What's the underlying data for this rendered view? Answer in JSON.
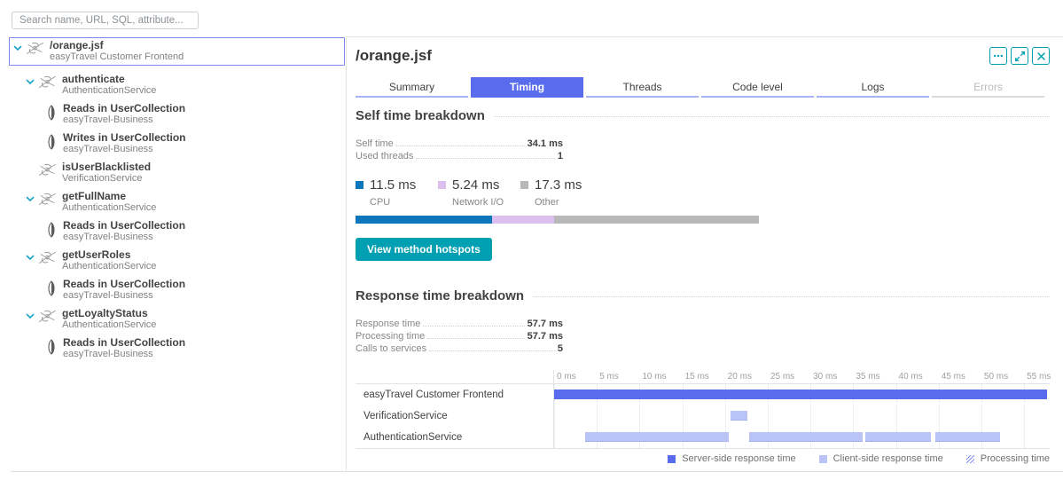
{
  "search": {
    "placeholder": "Search name, URL, SQL, attribute..."
  },
  "tree": {
    "items": [
      {
        "name": "/orange.jsf",
        "service": "easyTravel Customer Frontend",
        "level": 0,
        "icon": "service-icon",
        "expanded": true,
        "selected": true
      },
      {
        "name": "authenticate",
        "service": "AuthenticationService",
        "level": 1,
        "icon": "service-icon",
        "expanded": true
      },
      {
        "name": "Reads in UserCollection",
        "service": "easyTravel-Business",
        "level": 2,
        "icon": "database-icon"
      },
      {
        "name": "Writes in UserCollection",
        "service": "easyTravel-Business",
        "level": 2,
        "icon": "database-icon"
      },
      {
        "name": "isUserBlacklisted",
        "service": "VerificationService",
        "level": 1,
        "icon": "service-icon",
        "expanded": false
      },
      {
        "name": "getFullName",
        "service": "AuthenticationService",
        "level": 1,
        "icon": "service-icon",
        "expanded": true
      },
      {
        "name": "Reads in UserCollection",
        "service": "easyTravel-Business",
        "level": 2,
        "icon": "database-icon"
      },
      {
        "name": "getUserRoles",
        "service": "AuthenticationService",
        "level": 1,
        "icon": "service-icon",
        "expanded": true
      },
      {
        "name": "Reads in UserCollection",
        "service": "easyTravel-Business",
        "level": 2,
        "icon": "database-icon"
      },
      {
        "name": "getLoyaltyStatus",
        "service": "AuthenticationService",
        "level": 1,
        "icon": "service-icon",
        "expanded": true
      },
      {
        "name": "Reads in UserCollection",
        "service": "easyTravel-Business",
        "level": 2,
        "icon": "database-icon"
      }
    ]
  },
  "detail": {
    "title": "/orange.jsf",
    "actions": [
      {
        "name": "more-options-button",
        "icon": "ellipsis-icon"
      },
      {
        "name": "expand-button",
        "icon": "expand-icon"
      },
      {
        "name": "close-button",
        "icon": "close-icon"
      }
    ],
    "tabs": [
      {
        "label": "Summary"
      },
      {
        "label": "Timing",
        "active": true
      },
      {
        "label": "Threads"
      },
      {
        "label": "Code level"
      },
      {
        "label": "Logs"
      },
      {
        "label": "Errors",
        "disabled": true
      }
    ],
    "self_time_section": {
      "heading": "Self time breakdown",
      "metrics": [
        {
          "label": "Self time",
          "value": "34.1 ms"
        },
        {
          "label": "Used threads",
          "value": "1"
        }
      ],
      "button_label": "View method hotspots"
    },
    "response_section": {
      "heading": "Response time breakdown",
      "metrics": [
        {
          "label": "Response time",
          "value": "57.7 ms"
        },
        {
          "label": "Processing time",
          "value": "57.7 ms"
        },
        {
          "label": "Calls to services",
          "value": "5"
        }
      ]
    },
    "accent_colors": {
      "tab_blue": "#5a6cee",
      "teal": "#00a0b2"
    }
  },
  "chart_data": [
    {
      "type": "bar",
      "subtype": "stacked-horizontal",
      "title": "Self time breakdown",
      "total_ms": 34.1,
      "segments": [
        {
          "label": "CPU",
          "value_ms": 11.5,
          "display": "11.5 ms",
          "color": "#0e76ba"
        },
        {
          "label": "Network I/O",
          "value_ms": 5.24,
          "display": "5.24 ms",
          "color": "#dcbfee"
        },
        {
          "label": "Other",
          "value_ms": 17.3,
          "display": "17.3 ms",
          "color": "#b8b8b8"
        }
      ]
    },
    {
      "type": "table",
      "subtype": "timeline-gantt",
      "title": "Response time breakdown",
      "x_unit": "ms",
      "x_ticks_ms": [
        0,
        5,
        10,
        15,
        20,
        25,
        30,
        35,
        40,
        45,
        50,
        55
      ],
      "x_max_ms": 58,
      "rows": [
        {
          "label": "easyTravel Customer Frontend",
          "bars": [
            {
              "start_ms": 0,
              "end_ms": 57.7,
              "kind": "server"
            }
          ]
        },
        {
          "label": "VerificationService",
          "bars": [
            {
              "start_ms": 20.6,
              "end_ms": 22.6,
              "kind": "client"
            }
          ]
        },
        {
          "label": "AuthenticationService",
          "bars": [
            {
              "start_ms": 3.6,
              "end_ms": 20.4,
              "kind": "client"
            },
            {
              "start_ms": 22.8,
              "end_ms": 36.1,
              "kind": "client"
            },
            {
              "start_ms": 36.4,
              "end_ms": 44.1,
              "kind": "client"
            },
            {
              "start_ms": 44.6,
              "end_ms": 52.2,
              "kind": "client"
            }
          ]
        }
      ],
      "legend": [
        {
          "label": "Server-side response time",
          "swatch": "server"
        },
        {
          "label": "Client-side response time",
          "swatch": "client"
        },
        {
          "label": "Processing time",
          "swatch": "hatch"
        }
      ]
    }
  ]
}
